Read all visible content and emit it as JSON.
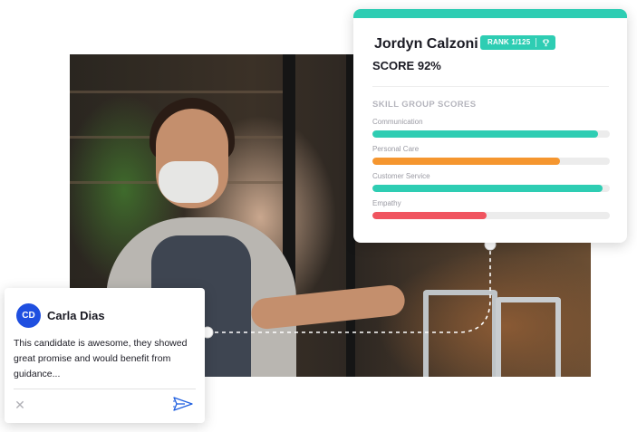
{
  "score_card": {
    "candidate_name": "Jordyn Calzoni",
    "rank_label": "RANK 1/125",
    "rank_icon": "trophy-icon",
    "score_label": "SCORE 92%",
    "section_title": "SKILL GROUP SCORES",
    "accent_color": "#2ecdb3",
    "skills": [
      {
        "label": "Communication",
        "level": 0.95,
        "color": "#2ecdb3"
      },
      {
        "label": "Personal Care",
        "level": 0.79,
        "color": "#f5962f"
      },
      {
        "label": "Customer Service",
        "level": 0.97,
        "color": "#2ecdb3"
      },
      {
        "label": "Empathy",
        "level": 0.48,
        "color": "#f0545f"
      }
    ]
  },
  "comment": {
    "avatar_initials": "CD",
    "avatar_color": "#1f4fe0",
    "author": "Carla Dias",
    "text": "This candidate is awesome, they showed great promise and would benefit from guidance...",
    "close_icon": "close-icon",
    "send_icon": "send-icon"
  }
}
